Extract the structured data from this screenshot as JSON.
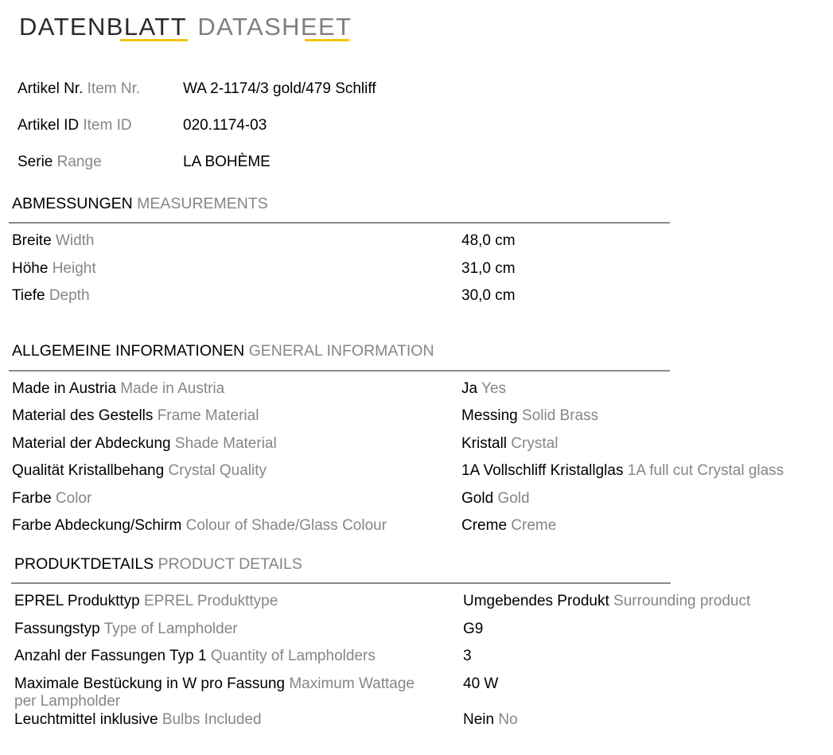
{
  "header": {
    "title_de": "DATENBLATT",
    "title_en": "DATASHEET"
  },
  "article": {
    "item_nr": {
      "label_de": "Artikel Nr.",
      "label_en": "Item Nr.",
      "value": "WA 2-1174/3 gold/479 Schliff"
    },
    "item_id": {
      "label_de": "Artikel ID",
      "label_en": "Item ID",
      "value": "020.1174-03"
    },
    "range": {
      "label_de": "Serie",
      "label_en": "Range",
      "value": "LA BOHÈME"
    }
  },
  "measurements": {
    "title_de": "ABMESSUNGEN",
    "title_en": "MEASUREMENTS",
    "rows": [
      {
        "label_de": "Breite",
        "label_en": "Width",
        "value_de": "48,0 cm",
        "value_en": ""
      },
      {
        "label_de": "Höhe",
        "label_en": "Height",
        "value_de": "31,0 cm",
        "value_en": ""
      },
      {
        "label_de": "Tiefe",
        "label_en": "Depth",
        "value_de": "30,0 cm",
        "value_en": ""
      }
    ]
  },
  "general": {
    "title_de": "ALLGEMEINE INFORMATIONEN",
    "title_en": "GENERAL INFORMATION",
    "rows": [
      {
        "label_de": "Made in Austria",
        "label_en": "Made in Austria",
        "value_de": "Ja",
        "value_en": "Yes"
      },
      {
        "label_de": "Material des Gestells",
        "label_en": "Frame Material",
        "value_de": "Messing",
        "value_en": "Solid Brass"
      },
      {
        "label_de": "Material der Abdeckung",
        "label_en": "Shade Material",
        "value_de": "Kristall",
        "value_en": "Crystal"
      },
      {
        "label_de": "Qualität Kristallbehang",
        "label_en": "Crystal Quality",
        "value_de": "1A Vollschliff Kristallglas",
        "value_en": "1A full cut Crystal glass"
      },
      {
        "label_de": "Farbe",
        "label_en": "Color",
        "value_de": "Gold",
        "value_en": "Gold"
      },
      {
        "label_de": "Farbe Abdeckung/Schirm",
        "label_en": "Colour of Shade/Glass Colour",
        "value_de": "Creme",
        "value_en": "Creme"
      }
    ]
  },
  "product": {
    "title_de": "PRODUKTDETAILS",
    "title_en": "PRODUCT DETAILS",
    "rows": [
      {
        "label_de": "EPREL Produkttyp",
        "label_en": "EPREL Produkttype",
        "value_de": "Umgebendes Produkt",
        "value_en": "Surrounding product"
      },
      {
        "label_de": "Fassungstyp",
        "label_en": "Type of Lampholder",
        "value_de": "G9",
        "value_en": ""
      },
      {
        "label_de": "Anzahl der Fassungen Typ 1",
        "label_en": "Quantity of Lampholders",
        "value_de": "3",
        "value_en": ""
      },
      {
        "label_de": "Maximale Bestückung in W pro Fassung",
        "label_en": "Maximum Wattage",
        "label_en_2": "per Lampholder",
        "value_de": "40 W",
        "value_en": ""
      },
      {
        "label_de": "Leuchtmittel inklusive",
        "label_en": "Bulbs Included",
        "value_de": "Nein",
        "value_en": "No"
      }
    ]
  },
  "colors": {
    "accent": "#f2c511",
    "english_text": "#868686",
    "rule": "#8a8a8a"
  }
}
